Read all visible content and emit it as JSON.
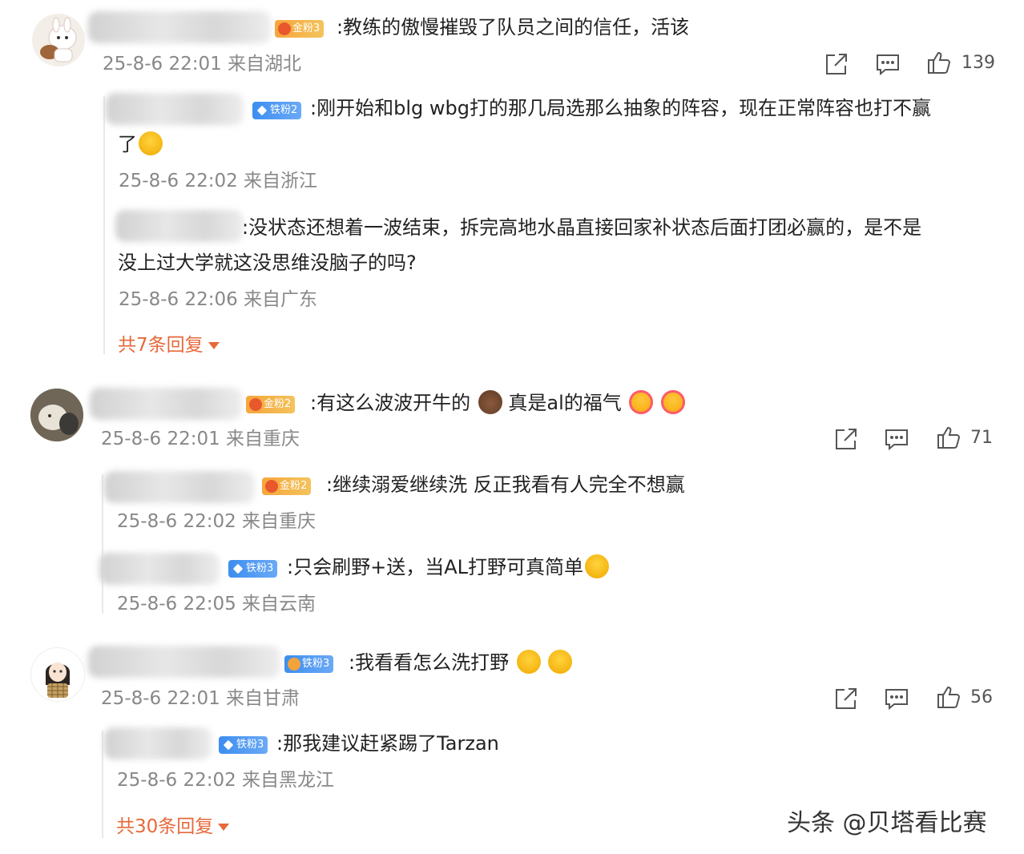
{
  "comments": [
    {
      "badge": "金粉3",
      "text": ":教练的傲慢摧毁了队员之间的信任，活该",
      "time": "25-8-6 22:01 来自湖北",
      "likes": "139",
      "replies": [
        {
          "badge": "铁粉2",
          "text1": ":刚开始和blg wbg打的那几局选那么抽象的阵容，现在正常阵容也打不赢",
          "text2": "了",
          "time": "25-8-6 22:02 来自浙江"
        },
        {
          "badge": "",
          "text1": ":没状态还想着一波结束，拆完高地水晶直接回家补状态后面打团必赢的，是不是",
          "text2": "没上过大学就这没思维没脑子的吗?",
          "time": "25-8-6 22:06 来自广东"
        }
      ],
      "more": "共7条回复"
    },
    {
      "badge": "金粉2",
      "text_a": ":有这么波波开牛的",
      "text_b": "真是al的福气",
      "time": "25-8-6 22:01 来自重庆",
      "likes": "71",
      "replies": [
        {
          "badge": "金粉2",
          "text": ":继续溺爱继续洗 反正我看有人完全不想赢",
          "time": "25-8-6 22:02 来自重庆"
        },
        {
          "badge": "铁粉3",
          "text": ":只会刷野+送，当AL打野可真简单",
          "time": "25-8-6 22:05 来自云南"
        }
      ]
    },
    {
      "badge": "铁粉3",
      "text": ":我看看怎么洗打野",
      "time": "25-8-6 22:01 来自甘肃",
      "likes": "56",
      "replies": [
        {
          "badge": "铁粉3",
          "text": ":那我建议赶紧踢了Tarzan",
          "time": "25-8-6 22:02 来自黑龙江"
        }
      ],
      "more": "共30条回复"
    }
  ],
  "watermark": "头条 @贝塔看比赛",
  "colors": {
    "accent": "#e6693a",
    "meta": "#888888",
    "gold_badge": "#f7a53a",
    "iron_badge": "#3d8ef0"
  },
  "icons": [
    "share-icon",
    "comment-icon",
    "like-icon"
  ]
}
